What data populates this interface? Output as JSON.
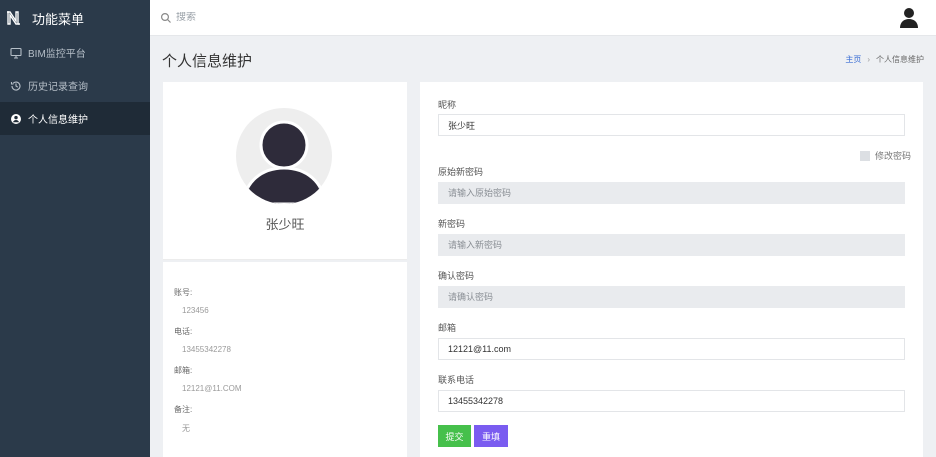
{
  "sidebar": {
    "title": "功能菜单",
    "items": [
      {
        "label": "BIM监控平台",
        "icon": "monitor-icon"
      },
      {
        "label": "历史记录查询",
        "icon": "history-icon"
      },
      {
        "label": "个人信息维护",
        "icon": "user-circle-icon"
      }
    ]
  },
  "topbar": {
    "search_placeholder": "搜索"
  },
  "page": {
    "title": "个人信息维护",
    "breadcrumb": {
      "home": "主页",
      "current": "个人信息维护"
    }
  },
  "profile": {
    "name": "张少旺",
    "fields": [
      {
        "label": "账号:",
        "value": "123456"
      },
      {
        "label": "电话:",
        "value": "13455342278"
      },
      {
        "label": "邮箱:",
        "value": "12121@11.COM"
      },
      {
        "label": "备注:",
        "value": "无"
      }
    ]
  },
  "form": {
    "nickname_label": "昵称",
    "nickname_value": "张少旺",
    "change_password_label": "修改密码",
    "old_password_label": "原始新密码",
    "old_password_placeholder": "请输入原始密码",
    "new_password_label": "新密码",
    "new_password_placeholder": "请输入新密码",
    "confirm_password_label": "确认密码",
    "confirm_password_placeholder": "请确认密码",
    "email_label": "邮箱",
    "email_value": "12121@11.com",
    "phone_label": "联系电话",
    "phone_value": "13455342278",
    "submit_label": "提交",
    "reset_label": "重填"
  },
  "colors": {
    "sidebar_bg": "#2b3a4a",
    "submit_btn": "#46c04b",
    "reset_btn": "#7a5cf0",
    "breadcrumb_link": "#3c6fd4"
  }
}
